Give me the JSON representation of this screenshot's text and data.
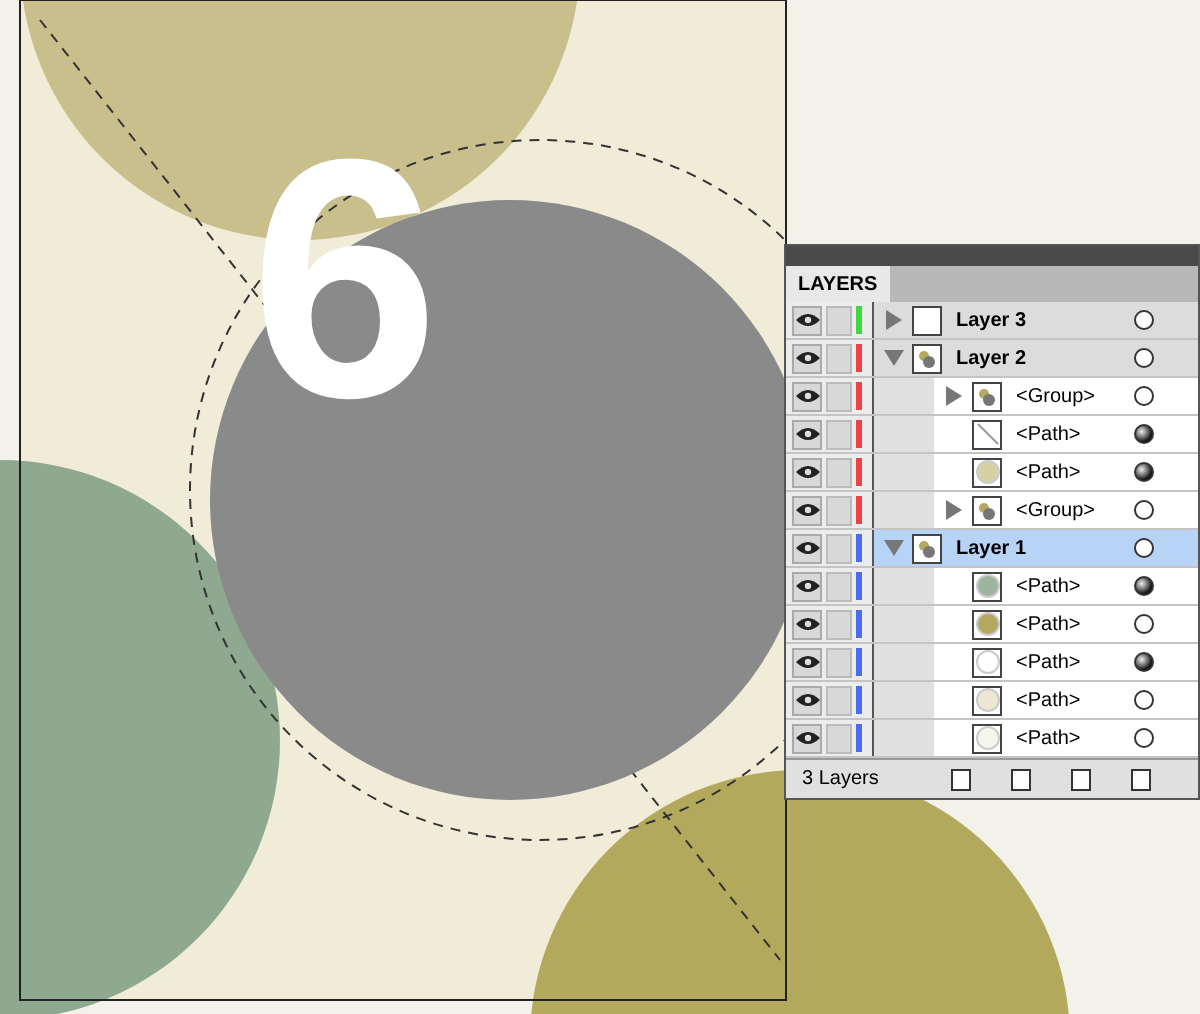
{
  "artwork": {
    "numeral": "6"
  },
  "panel": {
    "tab": "LAYERS",
    "footer": "3 Layers"
  },
  "layers": [
    {
      "kind": "layer",
      "name": "Layer 3",
      "color": "#3fd83f",
      "visible": true,
      "expanded": false,
      "selected": false,
      "targeted": false
    },
    {
      "kind": "layer",
      "name": "Layer 2",
      "color": "#ee4444",
      "visible": true,
      "expanded": true,
      "selected": false,
      "targeted": false,
      "children": [
        {
          "kind": "group",
          "name": "<Group>",
          "visible": true,
          "expanded": false,
          "targeted": false
        },
        {
          "kind": "path",
          "name": "<Path>",
          "visible": true,
          "targeted": true
        },
        {
          "kind": "path",
          "name": "<Path>",
          "color": "#d6d0a4",
          "visible": true,
          "targeted": true
        },
        {
          "kind": "group",
          "name": "<Group>",
          "visible": true,
          "expanded": false,
          "targeted": false
        }
      ]
    },
    {
      "kind": "layer",
      "name": "Layer 1",
      "color": "#4a6cf0",
      "visible": true,
      "expanded": true,
      "selected": true,
      "targeted": false,
      "children": [
        {
          "kind": "path",
          "name": "<Path>",
          "color": "#9db59e",
          "visible": true,
          "targeted": true
        },
        {
          "kind": "path",
          "name": "<Path>",
          "color": "#b5a860",
          "visible": true,
          "targeted": false
        },
        {
          "kind": "path",
          "name": "<Path>",
          "color": "#ffffff",
          "visible": true,
          "targeted": true
        },
        {
          "kind": "path",
          "name": "<Path>",
          "color": "#ece8d4",
          "visible": true,
          "targeted": false
        },
        {
          "kind": "path",
          "name": "<Path>",
          "color": "#f7f6ee",
          "visible": true,
          "targeted": false
        }
      ]
    }
  ]
}
